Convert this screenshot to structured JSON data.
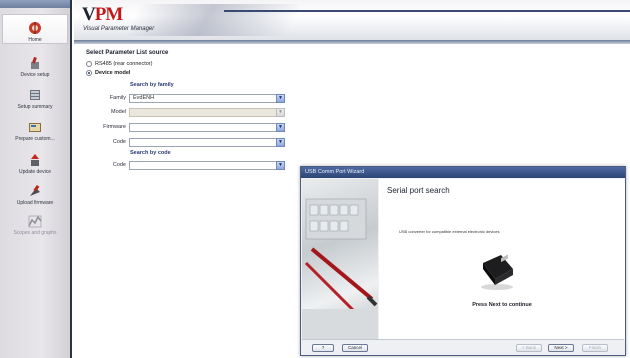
{
  "app": {
    "logo_text_a": "V",
    "logo_text_b": "PM",
    "subtitle": "Visual Parameter Manager"
  },
  "sidebar": {
    "items": [
      {
        "label": "Home",
        "icon": "home-icon",
        "active": true
      },
      {
        "label": "Device setup",
        "icon": "device-setup-icon"
      },
      {
        "label": "Setup summary",
        "icon": "setup-summary-icon"
      },
      {
        "label": "Prepare custom...",
        "icon": "prepare-custom-icon"
      },
      {
        "label": "Update device",
        "icon": "update-device-icon"
      },
      {
        "label": "Upload firmware",
        "icon": "upload-firmware-icon"
      },
      {
        "label": "Scopes and graphs",
        "icon": "scopes-graphs-icon",
        "disabled": true
      }
    ]
  },
  "form": {
    "title": "Select Parameter List source",
    "radio_rs485": "RS485 (rear connector)",
    "radio_device_model": "Device model",
    "search_by_family": "Search by family",
    "family_label": "Family",
    "family_value": "EvdENH",
    "model_label": "Model",
    "model_value": "",
    "firmware_label": "Firmware",
    "firmware_value": "",
    "code_label": "Code",
    "code_value": "",
    "search_by_code": "Search by code",
    "code2_label": "Code",
    "code2_value": ""
  },
  "wizard": {
    "title": "USB Comm Port Wizard",
    "heading": "Serial port search",
    "description": "USB converter for compatible external electronic devices",
    "continue_text": "Press Next to continue",
    "buttons": {
      "help": "?",
      "cancel": "Cancel",
      "back": "< Back",
      "next": "Next >",
      "finish": "Finish"
    }
  },
  "colors": {
    "brand_red": "#c21a1a",
    "accent_blue": "#2c4475"
  }
}
